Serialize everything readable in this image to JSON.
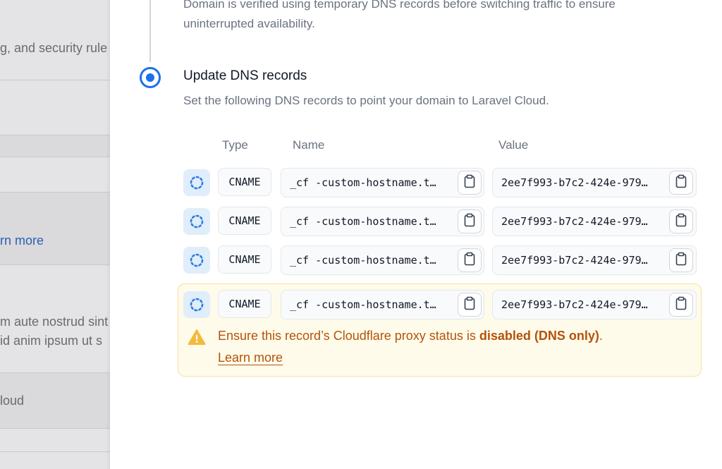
{
  "background": {
    "security_fragment": "g, and security rule",
    "learn_more_fragment": "rn more",
    "lorem_line1": "m aute nostrud sint",
    "lorem_line2": "id anim ipsum ut s",
    "cloud_fragment": "loud"
  },
  "previous_step": {
    "text_line1": "Domain is verified using temporary DNS records before switching traffic to ensure",
    "text_line2": "uninterrupted availability."
  },
  "step": {
    "title": "Update DNS records",
    "description": "Set the following DNS records to point your domain to Laravel Cloud."
  },
  "table": {
    "headers": {
      "type": "Type",
      "name": "Name",
      "value": "Value"
    },
    "rows": [
      {
        "status": "pending",
        "type": "CNAME",
        "name": "_cf -custom-hostname.t…",
        "value": "2ee7f993-b7c2-424e-979…"
      },
      {
        "status": "pending",
        "type": "CNAME",
        "name": "_cf -custom-hostname.t…",
        "value": "2ee7f993-b7c2-424e-979…"
      },
      {
        "status": "pending",
        "type": "CNAME",
        "name": "_cf -custom-hostname.t…",
        "value": "2ee7f993-b7c2-424e-979…"
      },
      {
        "status": "pending",
        "type": "CNAME",
        "name": "_cf -custom-hostname.t…",
        "value": "2ee7f993-b7c2-424e-979…"
      }
    ]
  },
  "warning": {
    "text_prefix": "Ensure this record’s Cloudflare proxy status ",
    "text_is": "is ",
    "text_bold": "disabled (DNS only)",
    "text_suffix": ".",
    "link": "Learn more"
  },
  "icons": {
    "status": "loading-dashed-circle-icon",
    "copy": "clipboard-icon",
    "warning": "warning-triangle-icon",
    "step": "radio-selected-icon"
  },
  "colors": {
    "accent": "#1f6feb",
    "warning_text": "#b45309",
    "warning_bg": "#fffbeb"
  }
}
